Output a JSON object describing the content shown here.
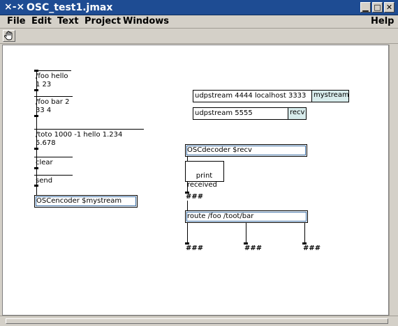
{
  "window": {
    "title": "OSC_test1.jmax",
    "logo": "⨯‑⨯",
    "controls": {
      "minimize": "▁",
      "maximize": "□",
      "close": "✕"
    }
  },
  "menu": {
    "file": "File",
    "edit": "Edit",
    "text": "Text",
    "project": "Project",
    "windows": "Windows",
    "help": "Help"
  },
  "toolbar": {
    "hand_tool_icon": "hand-icon"
  },
  "patch": {
    "messages": [
      {
        "text": "/foo hello\n1 23"
      },
      {
        "text": "/foo bar 2\n33 4"
      },
      {
        "text": "/toto 1000 -1 hello 1.234\n5.678"
      },
      {
        "text": "clear"
      },
      {
        "text": "send"
      }
    ],
    "osc_encoder": "OSCencoder $mystream",
    "udp_send": {
      "text": "udpstream 4444 localhost 3333",
      "tag": "mystream"
    },
    "udp_recv": {
      "text": "udpstream 5555",
      "tag": "recv"
    },
    "osc_decoder": "OSCdecoder $recv",
    "print": "print\nreceived",
    "route": "route /foo /toot/bar",
    "hash_symbol": "###"
  }
}
